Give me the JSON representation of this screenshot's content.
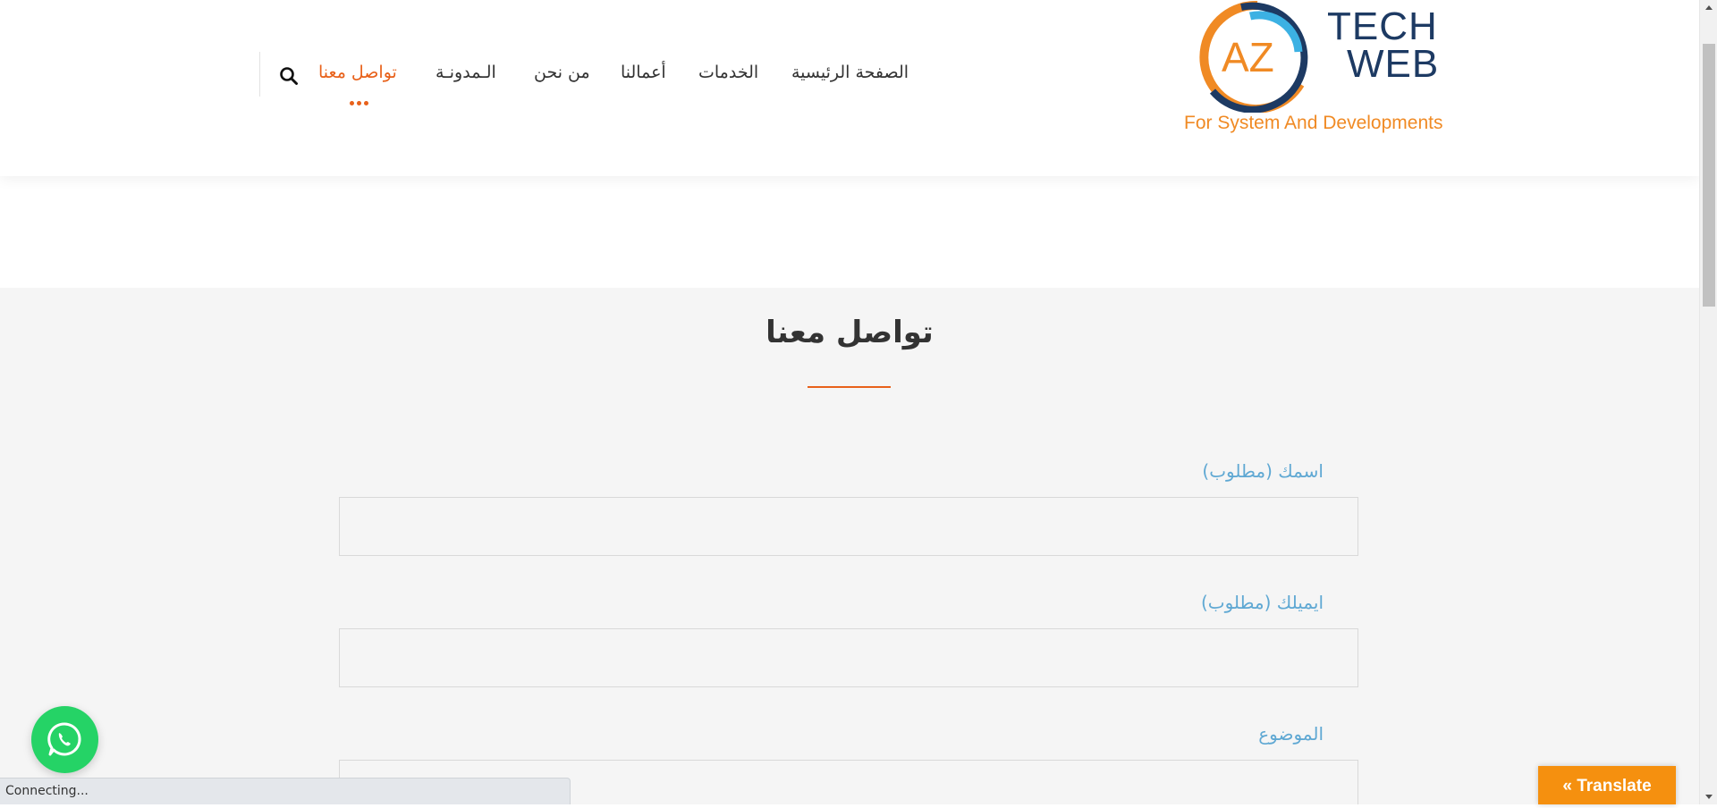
{
  "logo": {
    "letters": "AZ",
    "line1": "TECH",
    "line2": "WEB",
    "tagline": "For System And Developments"
  },
  "nav": {
    "home": "الصفحة الرئيسية",
    "services": "الخدمات",
    "works": "أعمالنا",
    "about": "من نحن",
    "blog": "الـمدونـة",
    "contact": "تواصل معنا",
    "active_item": "contact",
    "search_icon": "search-icon"
  },
  "main": {
    "title": "تواصل معنا",
    "fields": [
      {
        "label": "اسمك (مطلوب)",
        "value": ""
      },
      {
        "label": "ايميلك (مطلوب)",
        "value": ""
      },
      {
        "label": "الموضوع",
        "value": ""
      }
    ]
  },
  "widgets": {
    "whatsapp_icon": "whatsapp-icon",
    "translate_label": "« Translate"
  },
  "status_bar": {
    "text": "Connecting..."
  },
  "colors": {
    "accent": "#e8611a",
    "label_blue": "#5fa8d3",
    "logo_navy": "#1d3a63",
    "logo_orange": "#f08a24",
    "whatsapp_green": "#25d366",
    "translate_orange": "#f5900f"
  }
}
